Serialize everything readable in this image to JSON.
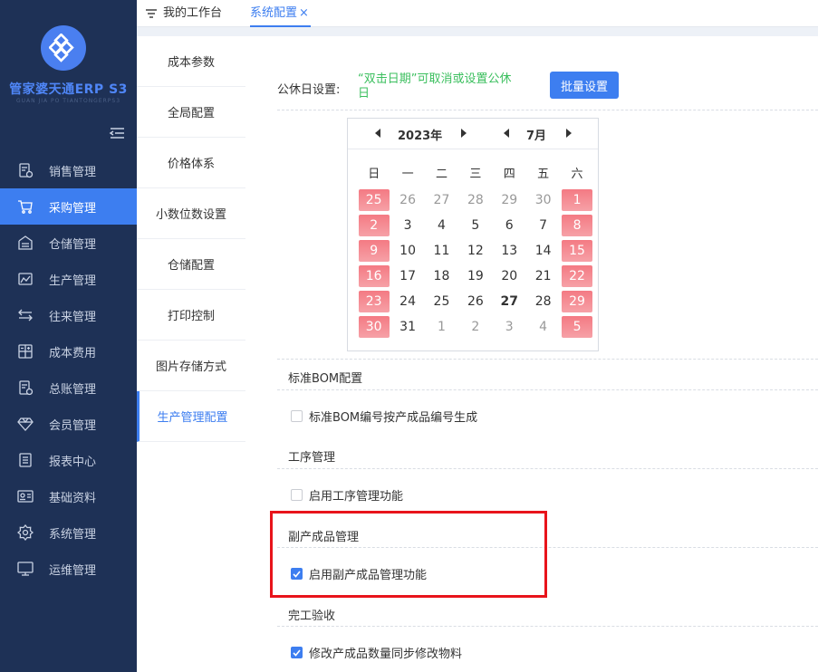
{
  "brand": {
    "name": "管家婆天通ERP S3",
    "subtitle": "GUAN JIA PO TIANTONGERPS3"
  },
  "sidebar": {
    "items": [
      {
        "label": "销售管理",
        "icon": "sales-doc-icon"
      },
      {
        "label": "采购管理",
        "icon": "cart-icon",
        "active": true
      },
      {
        "label": "仓储管理",
        "icon": "warehouse-icon"
      },
      {
        "label": "生产管理",
        "icon": "production-icon"
      },
      {
        "label": "往来管理",
        "icon": "exchange-icon"
      },
      {
        "label": "成本费用",
        "icon": "calculator-icon"
      },
      {
        "label": "总账管理",
        "icon": "ledger-icon"
      },
      {
        "label": "会员管理",
        "icon": "diamond-icon"
      },
      {
        "label": "报表中心",
        "icon": "report-icon"
      },
      {
        "label": "基础资料",
        "icon": "id-card-icon"
      },
      {
        "label": "系统管理",
        "icon": "gear-icon"
      },
      {
        "label": "运维管理",
        "icon": "monitor-icon"
      }
    ]
  },
  "tabs": {
    "home": "我的工作台",
    "system": "系统配置",
    "close": "×"
  },
  "submenu": {
    "items": [
      {
        "label": "成本参数"
      },
      {
        "label": "全局配置"
      },
      {
        "label": "价格体系"
      },
      {
        "label": "小数位数设置"
      },
      {
        "label": "仓储配置"
      },
      {
        "label": "打印控制"
      },
      {
        "label": "图片存储方式"
      },
      {
        "label": "生产管理配置",
        "active": true
      }
    ]
  },
  "holiday": {
    "label": "公休日设置:",
    "hint": "“双击日期”可取消或设置公休日",
    "batch_button": "批量设置"
  },
  "calendar": {
    "year": "2023年",
    "month": "7月",
    "weekdays": [
      "日",
      "一",
      "二",
      "三",
      "四",
      "五",
      "六"
    ],
    "weeks": [
      [
        {
          "d": "25",
          "t": "hol"
        },
        {
          "d": "26",
          "t": "other"
        },
        {
          "d": "27",
          "t": "other"
        },
        {
          "d": "28",
          "t": "other"
        },
        {
          "d": "29",
          "t": "other"
        },
        {
          "d": "30",
          "t": "other"
        },
        {
          "d": "1",
          "t": "hol"
        }
      ],
      [
        {
          "d": "2",
          "t": "hol"
        },
        {
          "d": "3",
          "t": ""
        },
        {
          "d": "4",
          "t": ""
        },
        {
          "d": "5",
          "t": ""
        },
        {
          "d": "6",
          "t": ""
        },
        {
          "d": "7",
          "t": ""
        },
        {
          "d": "8",
          "t": "hol"
        }
      ],
      [
        {
          "d": "9",
          "t": "hol"
        },
        {
          "d": "10",
          "t": ""
        },
        {
          "d": "11",
          "t": ""
        },
        {
          "d": "12",
          "t": ""
        },
        {
          "d": "13",
          "t": ""
        },
        {
          "d": "14",
          "t": ""
        },
        {
          "d": "15",
          "t": "hol"
        }
      ],
      [
        {
          "d": "16",
          "t": "hol"
        },
        {
          "d": "17",
          "t": ""
        },
        {
          "d": "18",
          "t": ""
        },
        {
          "d": "19",
          "t": ""
        },
        {
          "d": "20",
          "t": ""
        },
        {
          "d": "21",
          "t": ""
        },
        {
          "d": "22",
          "t": "hol"
        }
      ],
      [
        {
          "d": "23",
          "t": "hol"
        },
        {
          "d": "24",
          "t": ""
        },
        {
          "d": "25",
          "t": ""
        },
        {
          "d": "26",
          "t": ""
        },
        {
          "d": "27",
          "t": "today"
        },
        {
          "d": "28",
          "t": ""
        },
        {
          "d": "29",
          "t": "hol"
        }
      ],
      [
        {
          "d": "30",
          "t": "hol"
        },
        {
          "d": "31",
          "t": ""
        },
        {
          "d": "1",
          "t": "other"
        },
        {
          "d": "2",
          "t": "other"
        },
        {
          "d": "3",
          "t": "other"
        },
        {
          "d": "4",
          "t": "other"
        },
        {
          "d": "5",
          "t": "hol"
        }
      ]
    ]
  },
  "sections": {
    "bom": {
      "title": "标准BOM配置",
      "option": "标准BOM编号按产成品编号生成",
      "checked": false
    },
    "process": {
      "title": "工序管理",
      "option": "启用工序管理功能",
      "checked": false
    },
    "byproduct": {
      "title": "副产成品管理",
      "option": "启用副产成品管理功能",
      "checked": true
    },
    "completion": {
      "title": "完工验收",
      "option": "修改产成品数量同步修改物料",
      "checked": true
    }
  },
  "colors": {
    "sidebar_bg": "#1e3156",
    "accent": "#3d7ef0",
    "holiday": "#f47a83",
    "hint_green": "#3bbf5e",
    "highlight_red": "#e8141b"
  }
}
